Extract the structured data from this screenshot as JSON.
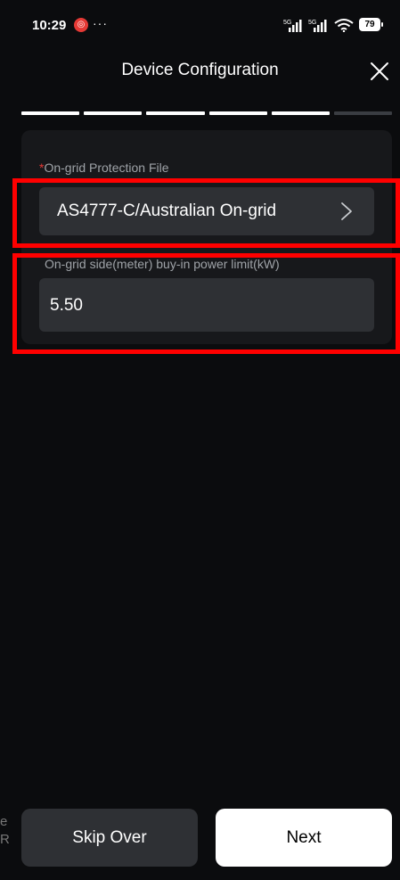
{
  "status_bar": {
    "time": "10:29",
    "alert_badge": "◎",
    "more": "···",
    "battery": "79",
    "net_1": "5G",
    "net_2": "5G"
  },
  "header": {
    "title": "Device Configuration"
  },
  "progress": {
    "steps_total": 6,
    "steps_done": 5
  },
  "form": {
    "protection_file": {
      "required_mark": "*",
      "label": "On-grid Protection File",
      "value": "AS4777-C/Australian On-grid"
    },
    "buy_in_limit": {
      "label": "On-grid side(meter) buy-in power limit(kW)",
      "value": "5.50"
    }
  },
  "footer": {
    "skip_label": "Skip Over",
    "next_label": "Next",
    "edge_text_1": "e",
    "edge_text_2": "R"
  },
  "colors": {
    "background": "#0b0c0e",
    "card": "#17181b",
    "field": "#2e3034",
    "required": "#e53935",
    "highlight": "#ff0000"
  }
}
